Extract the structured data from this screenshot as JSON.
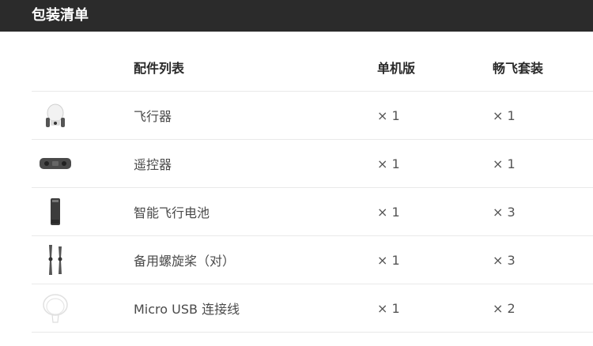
{
  "header": {
    "title": "包装清单"
  },
  "table": {
    "columns": [
      "配件列表",
      "单机版",
      "畅飞套装"
    ],
    "rows": [
      {
        "icon": "drone-icon",
        "name": "飞行器",
        "standard": "× 1",
        "combo": "× 1"
      },
      {
        "icon": "remote-controller-icon",
        "name": "遥控器",
        "standard": "× 1",
        "combo": "× 1"
      },
      {
        "icon": "battery-icon",
        "name": "智能飞行电池",
        "standard": "× 1",
        "combo": "× 3"
      },
      {
        "icon": "propellers-icon",
        "name": "备用螺旋桨（对）",
        "standard": "× 1",
        "combo": "× 3"
      },
      {
        "icon": "usb-cable-icon",
        "name": "Micro USB 连接线",
        "standard": "× 1",
        "combo": "× 2"
      }
    ]
  }
}
